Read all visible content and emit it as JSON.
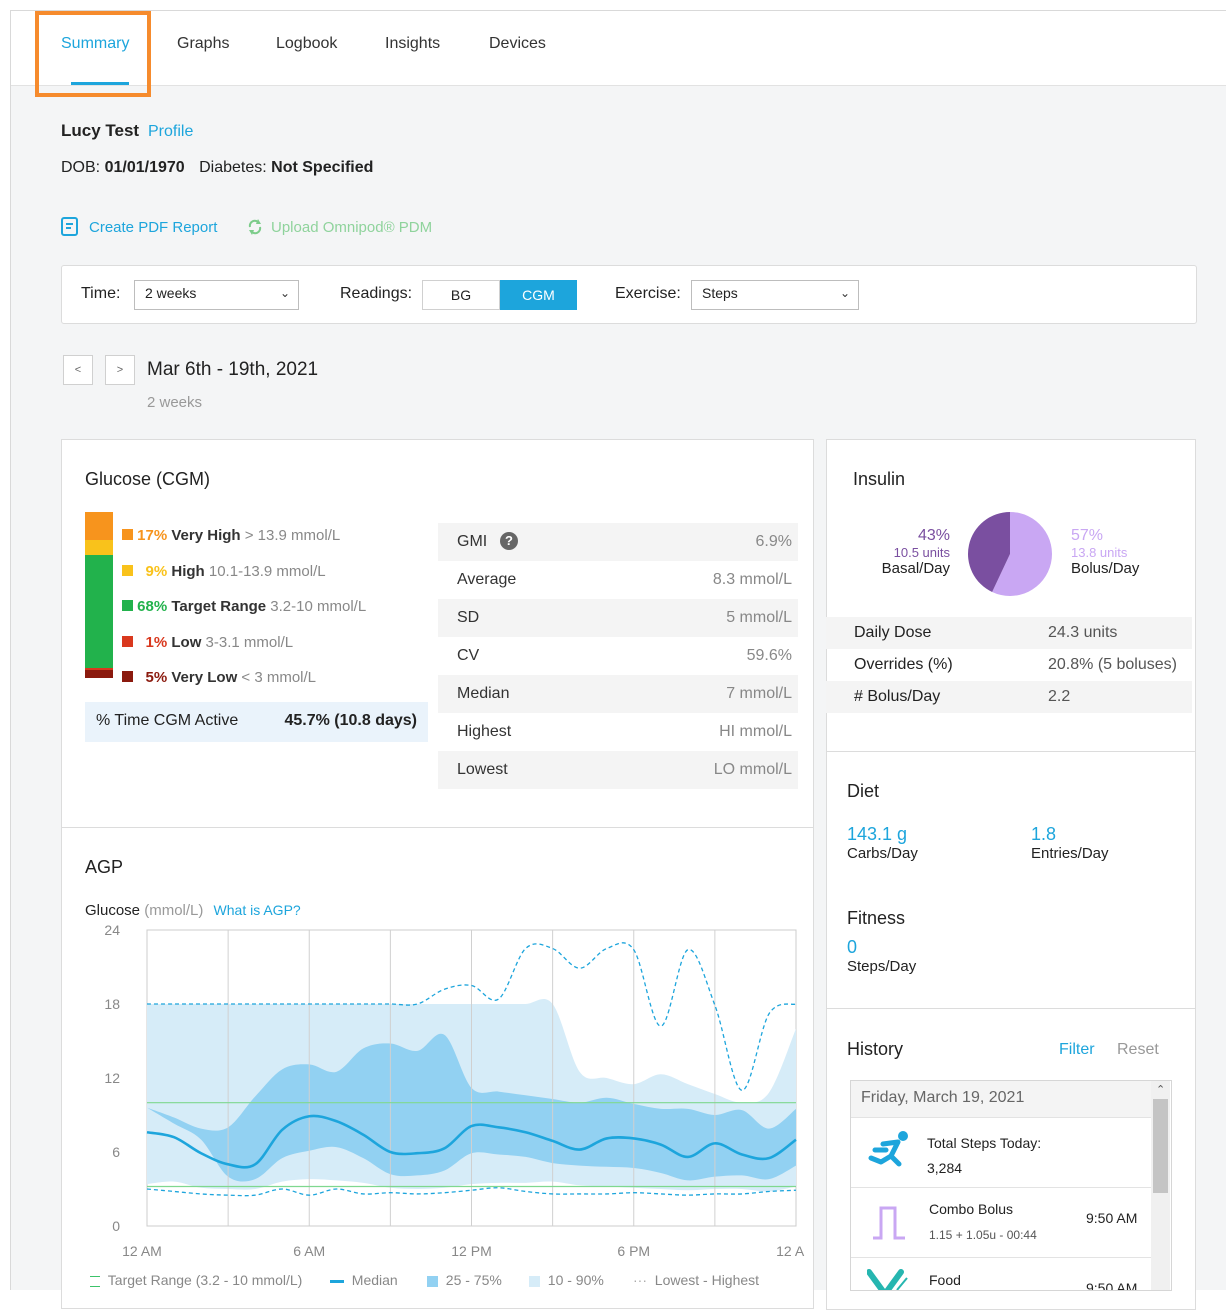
{
  "tabs": [
    {
      "label": "Summary",
      "active": true
    },
    {
      "label": "Graphs"
    },
    {
      "label": "Logbook"
    },
    {
      "label": "Insights"
    },
    {
      "label": "Devices"
    }
  ],
  "patient": {
    "name": "Lucy Test",
    "profile_link": "Profile",
    "dob_label": "DOB:",
    "dob": "01/01/1970",
    "diabetes_label": "Diabetes:",
    "diabetes": "Not Specified"
  },
  "actions": {
    "create_pdf": "Create PDF Report",
    "upload": "Upload Omnipod® PDM"
  },
  "filters": {
    "time_label": "Time:",
    "time_value": "2 weeks",
    "readings_label": "Readings:",
    "readings_bg": "BG",
    "readings_cgm": "CGM",
    "readings_selected": "CGM",
    "exercise_label": "Exercise:",
    "exercise_value": "Steps"
  },
  "range": {
    "prev": "<",
    "next": ">",
    "dates": "Mar 6th - 19th, 2021",
    "duration": "2 weeks"
  },
  "glucose": {
    "title": "Glucose (CGM)",
    "ranges": [
      {
        "pct": "17%",
        "name": "Very High",
        "desc": "> 13.9 mmol/L",
        "color": "#f7941d",
        "value": 17
      },
      {
        "pct": "9%",
        "name": "High",
        "desc": "10.1-13.9 mmol/L",
        "color": "#f9c21b",
        "value": 9
      },
      {
        "pct": "68%",
        "name": "Target Range",
        "desc": "3.2-10 mmol/L",
        "color": "#22b24c",
        "value": 68
      },
      {
        "pct": "1%",
        "name": "Low",
        "desc": "3-3.1 mmol/L",
        "color": "#d9381e",
        "value": 1
      },
      {
        "pct": "5%",
        "name": "Very Low",
        "desc": "< 3 mmol/L",
        "color": "#8b1a0e",
        "value": 5
      }
    ],
    "active_label": "% Time CGM Active",
    "active_value": "45.7% (10.8 days)",
    "stats": [
      {
        "label": "GMI",
        "value": "6.9%"
      },
      {
        "label": "Average",
        "value": "8.3 mmol/L"
      },
      {
        "label": "SD",
        "value": "5 mmol/L"
      },
      {
        "label": "CV",
        "value": "59.6%"
      },
      {
        "label": "Median",
        "value": "7 mmol/L"
      },
      {
        "label": "Highest",
        "value": "HI mmol/L"
      },
      {
        "label": "Lowest",
        "value": "LO mmol/L"
      }
    ]
  },
  "agp": {
    "title": "AGP",
    "axis_label": "Glucose",
    "axis_unit": "(mmol/L)",
    "what_link": "What is AGP?",
    "legend": [
      "Target Range (3.2 - 10 mmol/L)",
      "Median",
      "25 - 75%",
      "10 - 90%",
      "Lowest - Highest"
    ]
  },
  "chart_data": {
    "type": "area",
    "title": "AGP",
    "ylabel": "Glucose (mmol/L)",
    "ylim": [
      0,
      24
    ],
    "yticks": [
      "24",
      "18",
      "12",
      "6",
      "0"
    ],
    "xticks": [
      "12 AM",
      "6 AM",
      "12 PM",
      "6 PM",
      "12 AM"
    ],
    "target_range": [
      3.2,
      10
    ],
    "x_hours": [
      0,
      1,
      2,
      3,
      4,
      5,
      6,
      7,
      8,
      9,
      10,
      11,
      12,
      13,
      14,
      15,
      16,
      17,
      18,
      19,
      20,
      21,
      22,
      23,
      24
    ],
    "series": [
      {
        "name": "Median",
        "values": [
          7.6,
          7.2,
          5.9,
          5.0,
          5.0,
          7.8,
          8.9,
          8.5,
          7.4,
          6.0,
          5.9,
          6.3,
          8.1,
          8.0,
          7.6,
          6.9,
          6.2,
          7.1,
          7.1,
          6.6,
          5.6,
          6.7,
          5.8,
          5.5,
          7.0
        ]
      },
      {
        "name": "25 - 75%",
        "low": [
          9.6,
          8.3,
          7.0,
          4.0,
          3.8,
          5.5,
          6.1,
          6.4,
          5.5,
          4.2,
          4.1,
          4.5,
          5.9,
          5.8,
          5.6,
          5.1,
          4.9,
          4.8,
          4.7,
          4.3,
          3.7,
          4.0,
          4.1,
          3.8,
          4.9
        ],
        "high": [
          9.6,
          8.8,
          7.9,
          8.0,
          10.5,
          12.7,
          13.1,
          12.5,
          14.4,
          14.8,
          14.2,
          15.5,
          11.2,
          10.9,
          10.6,
          10.3,
          10.0,
          10.4,
          9.9,
          9.5,
          9.5,
          9.0,
          9.4,
          7.9,
          9.5
        ]
      },
      {
        "name": "10 - 90%",
        "low": [
          3.4,
          3.6,
          3.1,
          3.0,
          3.0,
          3.6,
          3.8,
          3.7,
          3.5,
          3.1,
          3.0,
          3.1,
          3.4,
          3.5,
          3.5,
          3.6,
          3.3,
          3.2,
          3.1,
          3.0,
          2.9,
          3.0,
          3.0,
          2.8,
          3.2
        ],
        "high": [
          18.0,
          18.0,
          18.0,
          18.0,
          18.0,
          18.0,
          18.0,
          18.0,
          18.0,
          18.0,
          18.0,
          18.0,
          18.0,
          18.0,
          18.0,
          18.0,
          12.5,
          12.0,
          11.5,
          12.3,
          11.5,
          10.7,
          10.0,
          10.8,
          16.0
        ]
      },
      {
        "name": "Lowest - Highest",
        "low": [
          3.0,
          2.8,
          2.6,
          2.5,
          2.5,
          3.0,
          2.5,
          3.0,
          2.6,
          2.7,
          2.6,
          2.7,
          2.9,
          3.1,
          2.8,
          2.6,
          2.6,
          2.6,
          2.7,
          2.6,
          2.5,
          2.6,
          2.6,
          2.8,
          2.9
        ],
        "high": [
          18.0,
          18.0,
          18.0,
          18.0,
          18.0,
          18.0,
          18.0,
          18.0,
          18.0,
          18.0,
          18.0,
          19.2,
          19.5,
          18.4,
          22.5,
          22.5,
          20.9,
          22.5,
          22.4,
          16.2,
          22.4,
          17.9,
          11.0,
          17.2,
          18.0
        ]
      }
    ]
  },
  "insulin": {
    "title": "Insulin",
    "basal_pct": "43%",
    "basal_units": "10.5 units",
    "basal_label": "Basal/Day",
    "bolus_pct": "57%",
    "bolus_units": "13.8 units",
    "bolus_label": "Bolus/Day",
    "basal_value": 43,
    "bolus_value": 57,
    "basal_color": "#7a4fa0",
    "bolus_color": "#c9a7f3",
    "rows": [
      {
        "label": "Daily Dose",
        "value": "24.3 units"
      },
      {
        "label": "Overrides (%)",
        "value": "20.8% (5 boluses)"
      },
      {
        "label": "# Bolus/Day",
        "value": "2.2"
      }
    ]
  },
  "diet": {
    "title": "Diet",
    "carbs_value": "143.1 g",
    "carbs_label": "Carbs/Day",
    "entries_value": "1.8",
    "entries_label": "Entries/Day"
  },
  "fitness": {
    "title": "Fitness",
    "steps_value": "0",
    "steps_label": "Steps/Day"
  },
  "history": {
    "title": "History",
    "filter": "Filter",
    "reset": "Reset",
    "date": "Friday, March 19, 2021",
    "items": [
      {
        "title": "Total Steps Today:",
        "sub": "3,284",
        "time": "",
        "icon": "running-icon"
      },
      {
        "title": "Combo Bolus",
        "sub": "1.15 + 1.05u - 00:44",
        "time": "9:50 AM",
        "icon": "combo-bolus-icon"
      },
      {
        "title": "Food",
        "sub": "",
        "time": "9:50 AM",
        "icon": "food-icon"
      }
    ]
  }
}
